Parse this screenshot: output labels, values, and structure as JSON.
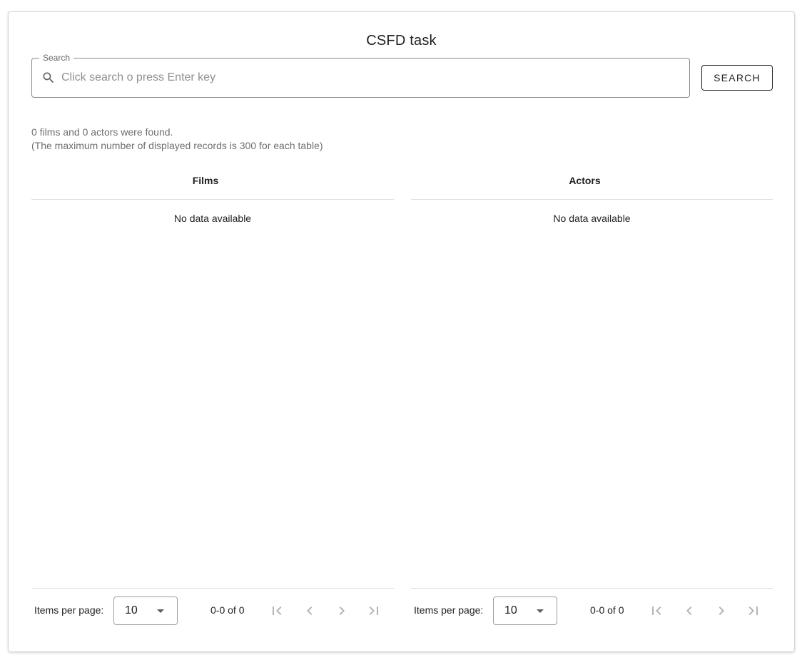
{
  "header": {
    "title": "CSFD task"
  },
  "search": {
    "legend": "Search",
    "placeholder": "Click search o press Enter key",
    "value": "",
    "button_label": "SEARCH"
  },
  "summary": {
    "line1": "0 films and 0 actors were found.",
    "line2": "(The maximum number of displayed records is 300 for each table)"
  },
  "tables": [
    {
      "header": "Films",
      "empty_text": "No data available",
      "footer": {
        "items_per_page_label": "Items per page:",
        "items_per_page_value": "10",
        "page_info": "0-0 of 0"
      }
    },
    {
      "header": "Actors",
      "empty_text": "No data available",
      "footer": {
        "items_per_page_label": "Items per page:",
        "items_per_page_value": "10",
        "page_info": "0-0 of 0"
      }
    }
  ],
  "icons": {
    "search": "search-icon",
    "first_page": "first-page-icon",
    "prev_page": "chevron-left-icon",
    "next_page": "chevron-right-icon",
    "last_page": "last-page-icon",
    "dropdown": "caret-down-icon"
  },
  "colors": {
    "text": "#212121",
    "muted_text": "#6f6f6f",
    "disabled_icon": "#b4b4b4",
    "border": "#e0e0e0"
  }
}
